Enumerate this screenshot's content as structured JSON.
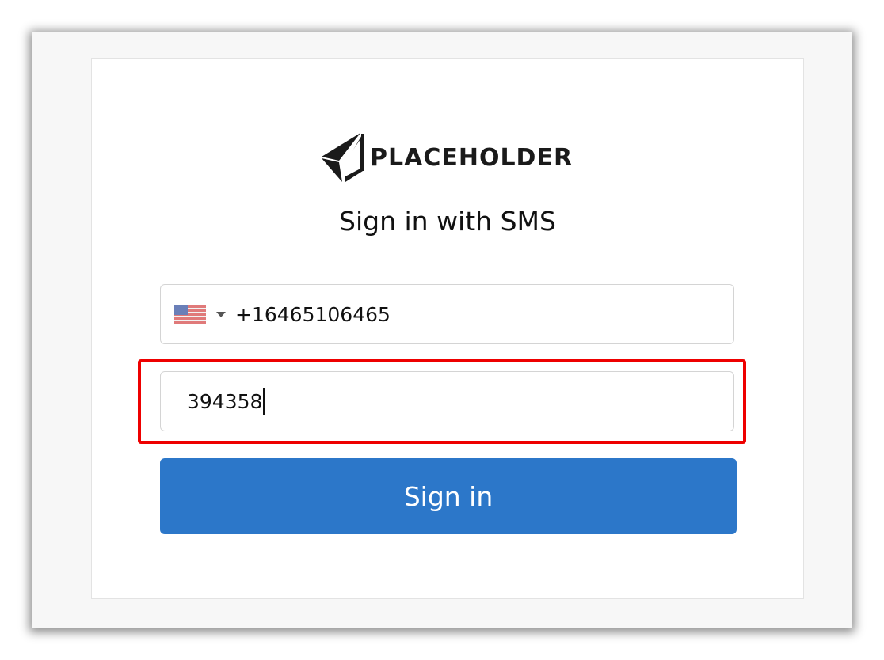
{
  "brand": {
    "name": "PLACEHOLDER",
    "logo_icon": "paper-plane-logo-icon"
  },
  "heading": "Sign in with SMS",
  "phone": {
    "country_flag": "us-flag-icon",
    "country_dropdown_icon": "caret-down-icon",
    "value": "+16465106465"
  },
  "code": {
    "value": "394358"
  },
  "signin_button": {
    "label": "Sign in"
  },
  "colors": {
    "button": "#2c77c9",
    "highlight": "#ee0000"
  }
}
